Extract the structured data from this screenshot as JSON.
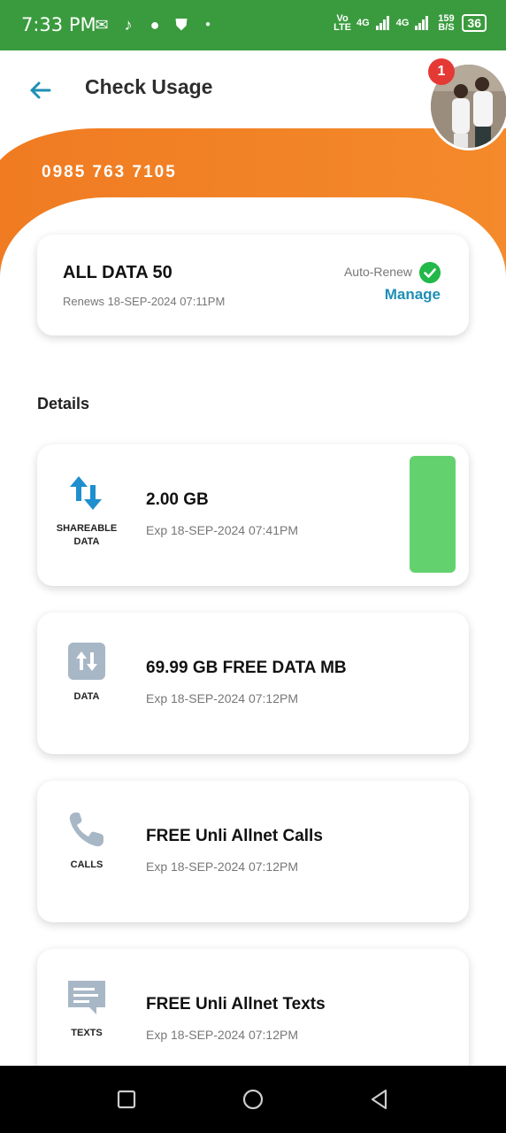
{
  "status_bar": {
    "time": "7:33 PM",
    "network1": "Vo LTE",
    "network2": "4G",
    "network3": "4G",
    "speed": "159 B/S",
    "battery": "36"
  },
  "header": {
    "title": "Check Usage",
    "notification_count": "1"
  },
  "account": {
    "phone_number": "0985 763 7105"
  },
  "plan": {
    "name": "ALL DATA 50",
    "renews": "Renews 18-SEP-2024 07:11PM",
    "auto_renew_label": "Auto-Renew",
    "manage_label": "Manage"
  },
  "details_heading": "Details",
  "details": [
    {
      "icon": "shareable-data-icon",
      "label": "SHAREABLE DATA",
      "main": "2.00 GB",
      "exp": "Exp 18-SEP-2024 07:41PM",
      "usage_fraction_remaining": 1.0
    },
    {
      "icon": "data-icon",
      "label": "DATA",
      "main": "69.99 GB FREE DATA MB",
      "exp": "Exp 18-SEP-2024 07:12PM"
    },
    {
      "icon": "phone-icon",
      "label": "CALLS",
      "main": "FREE Unli Allnet Calls",
      "exp": "Exp 18-SEP-2024 07:12PM"
    },
    {
      "icon": "message-icon",
      "label": "TEXTS",
      "main": "FREE Unli Allnet Texts",
      "exp": "Exp 18-SEP-2024 07:12PM"
    }
  ],
  "colors": {
    "status_bar": "#3a9b3e",
    "brand_orange": "#f07b22",
    "accent_blue": "#1f8fb4",
    "usage_green": "#63d26e"
  }
}
